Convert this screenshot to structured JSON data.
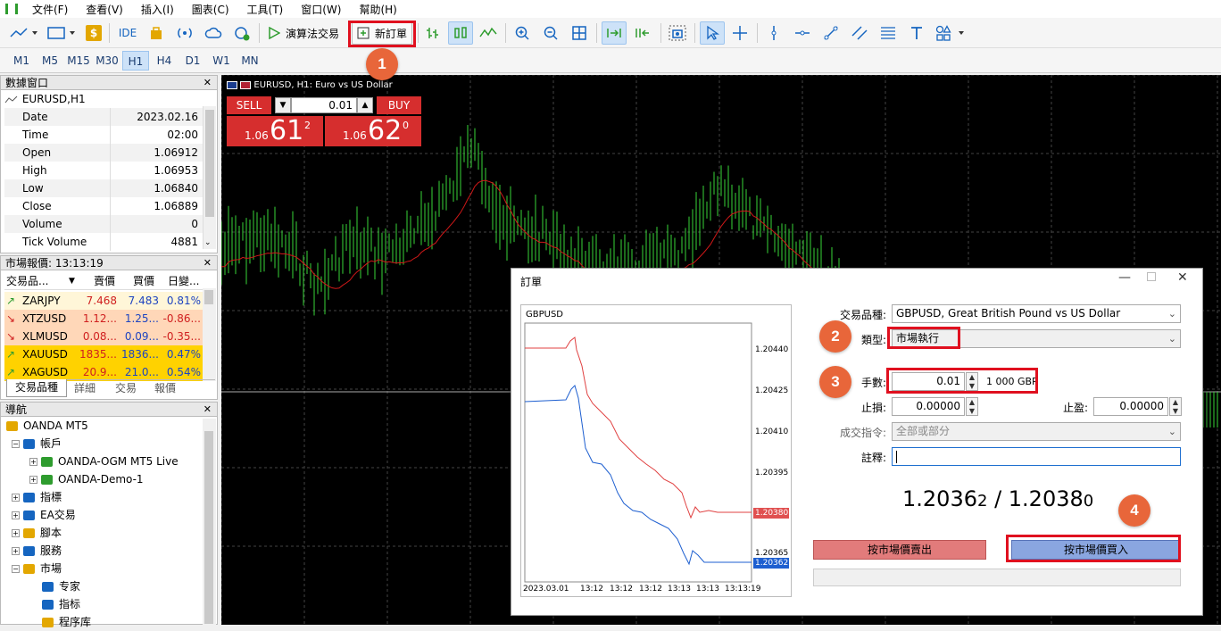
{
  "menu": [
    "文件(F)",
    "查看(V)",
    "插入(I)",
    "圖表(C)",
    "工具(T)",
    "窗口(W)",
    "幫助(H)"
  ],
  "toolbar": {
    "ide_label": "IDE",
    "algo_label": "演算法交易",
    "new_order_label": "新訂單"
  },
  "timeframes": [
    "M1",
    "M5",
    "M15",
    "M30",
    "H1",
    "H4",
    "D1",
    "W1",
    "MN"
  ],
  "active_timeframe": "H1",
  "data_window": {
    "title": "數據窗口",
    "symbol": "EURUSD,H1",
    "rows": [
      {
        "k": "Date",
        "v": "2023.02.16"
      },
      {
        "k": "Time",
        "v": "02:00"
      },
      {
        "k": "Open",
        "v": "1.06912"
      },
      {
        "k": "High",
        "v": "1.06953"
      },
      {
        "k": "Low",
        "v": "1.06840"
      },
      {
        "k": "Close",
        "v": "1.06889"
      },
      {
        "k": "Volume",
        "v": "0"
      },
      {
        "k": "Tick Volume",
        "v": "4881"
      }
    ]
  },
  "market_watch": {
    "title": "市場報價: 13:13:19",
    "headers": [
      "交易品...",
      "賣價",
      "買價",
      "日變..."
    ],
    "rows": [
      {
        "sym": "ZARJPY",
        "bid": "7.468",
        "ask": "7.483",
        "chg": "0.81%",
        "dir": "up",
        "bg": "#fff6d8"
      },
      {
        "sym": "XTZUSD",
        "bid": "1.12...",
        "ask": "1.25...",
        "chg": "-0.86...",
        "dir": "down",
        "bg": "#ffd7b8"
      },
      {
        "sym": "XLMUSD",
        "bid": "0.08...",
        "ask": "0.09...",
        "chg": "-0.35...",
        "dir": "down",
        "bg": "#ffd7b8"
      },
      {
        "sym": "XAUUSD",
        "bid": "1835...",
        "ask": "1836...",
        "chg": "0.47%",
        "dir": "up",
        "bg": "#ffd200"
      },
      {
        "sym": "XAGUSD",
        "bid": "20.9...",
        "ask": "21.0...",
        "chg": "0.54%",
        "dir": "up",
        "bg": "#ffd200"
      }
    ],
    "tabs": [
      "交易品種",
      "詳細",
      "交易",
      "報價"
    ]
  },
  "navigator": {
    "title": "導航",
    "items": [
      {
        "label": "OANDA MT5",
        "level": 0
      },
      {
        "label": "帳戶",
        "level": 1
      },
      {
        "label": "OANDA-OGM MT5 Live",
        "level": 2
      },
      {
        "label": "OANDA-Demo-1",
        "level": 2
      },
      {
        "label": "指標",
        "level": 1
      },
      {
        "label": "EA交易",
        "level": 1
      },
      {
        "label": "腳本",
        "level": 1
      },
      {
        "label": "服務",
        "level": 1
      },
      {
        "label": "市場",
        "level": 1
      },
      {
        "label": "专家",
        "level": 2
      },
      {
        "label": "指标",
        "level": 2
      },
      {
        "label": "程序库",
        "level": 2
      }
    ]
  },
  "chart": {
    "title": "EURUSD, H1:  Euro vs US Dollar",
    "sell_label": "SELL",
    "buy_label": "BUY",
    "lot": "0.01",
    "sell_price_prefix": "1.06",
    "sell_price_big": "61",
    "sell_price_sup": "2",
    "buy_price_prefix": "1.06",
    "buy_price_big": "62",
    "buy_price_sup": "0"
  },
  "order_dialog": {
    "title": "訂單",
    "symbol_label": "交易品種:",
    "symbol_value": "GBPUSD, Great British Pound vs US Dollar",
    "type_label": "類型:",
    "type_value": "市場執行",
    "volume_label": "手數:",
    "volume_value": "0.01",
    "volume_note": "1 000 GBP",
    "sl_label": "止損:",
    "sl_value": "0.00000",
    "tp_label": "止盈:",
    "tp_value": "0.00000",
    "fill_label": "成交指令:",
    "fill_value": "全部或部分",
    "comment_label": "註釋:",
    "bid_main": "1.2036",
    "bid_small": "2",
    "separator": " / ",
    "ask_main": "1.2038",
    "ask_small": "0",
    "sell_button": "按市場價賣出",
    "buy_button": "按市場價買入",
    "mini_chart": {
      "symbol": "GBPUSD",
      "y_ticks": [
        "1.20440",
        "1.20425",
        "1.20410",
        "1.20395",
        "1.20380",
        "1.20365",
        "1.20362"
      ],
      "x_ticks": [
        "2023.03.01",
        "13:12",
        "13:12",
        "13:12",
        "13:13",
        "13:13",
        "13:13:19"
      ],
      "ask_tag": "1.20380",
      "bid_tag": "1.20362"
    }
  },
  "badges": [
    "1",
    "2",
    "3",
    "4"
  ]
}
